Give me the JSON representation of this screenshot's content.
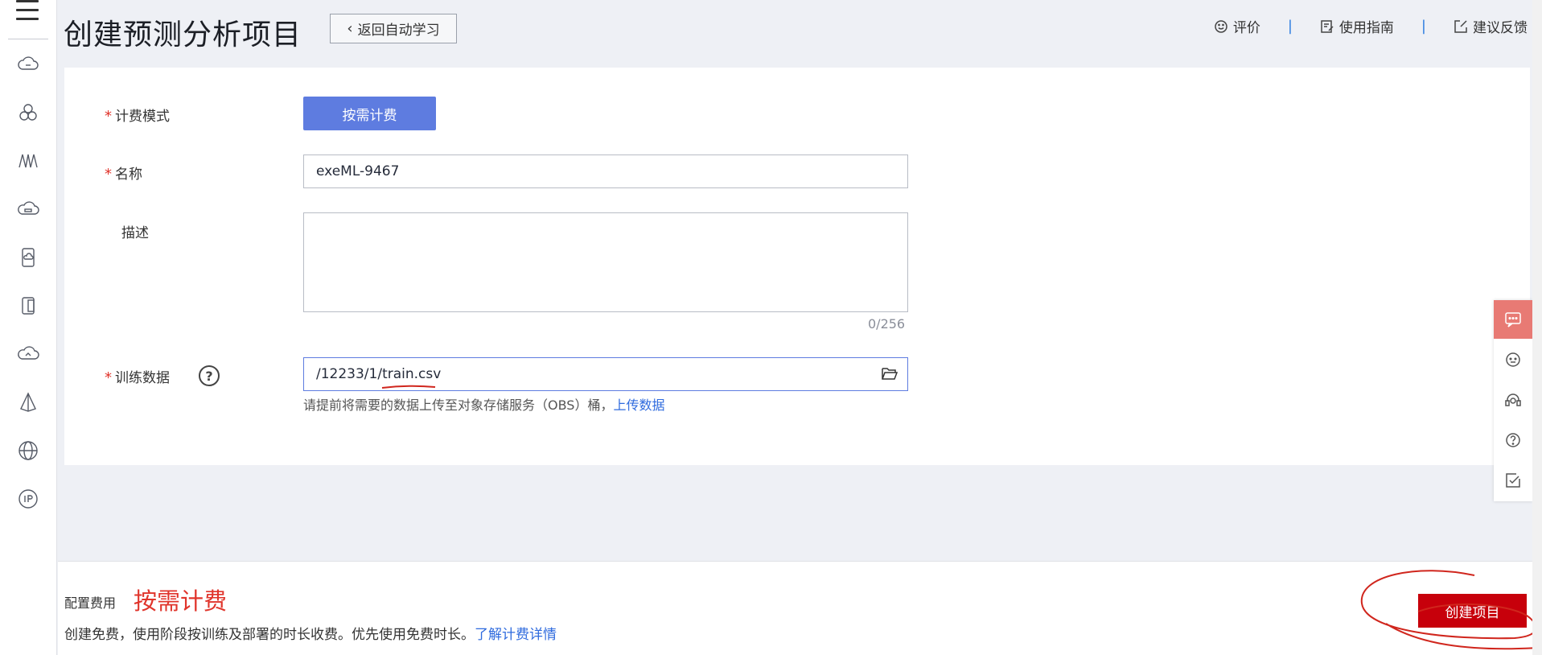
{
  "header": {
    "title": "创建预测分析项目",
    "back_label": "返回自动学习",
    "links": [
      {
        "label": "评价",
        "icon": "smile-icon"
      },
      {
        "label": "使用指南",
        "icon": "guide-icon"
      },
      {
        "label": "建议反馈",
        "icon": "feedback-icon"
      }
    ],
    "separator": "|"
  },
  "rail": {
    "icons": [
      "menu-icon",
      "cloud-icon",
      "cluster-icon",
      "waveform-icon",
      "cloud-storage-icon",
      "mobile-cloud-icon",
      "device-icon",
      "cloud-sync-icon",
      "pyramid-icon",
      "globe-icon",
      "ip-icon"
    ]
  },
  "form": {
    "billing_mode": {
      "label": "计费模式",
      "value": "按需计费"
    },
    "name": {
      "label": "名称",
      "value": "exeML-9467"
    },
    "description": {
      "label": "描述",
      "value": "",
      "counter": "0/256"
    },
    "training_data": {
      "label": "训练数据",
      "help": "?",
      "value": "/12233/1/train.csv",
      "hint": "请提前将需要的数据上传至对象存储服务（OBS）桶，",
      "hint_link": "上传数据"
    },
    "required_mark": "*"
  },
  "footer": {
    "fee_label": "配置费用",
    "fee_value": "按需计费",
    "fee_desc": "创建免费，使用阶段按训练及部署的时长收费。优先使用免费时长。",
    "fee_link": "了解计费详情",
    "create_label": "创建项目"
  },
  "floatbar": {
    "icons": [
      "chat-icon",
      "robot-icon",
      "headset-icon",
      "question-icon",
      "edit-note-icon"
    ]
  },
  "colors": {
    "accent": "#5e7ce0",
    "primary_red": "#c7000b",
    "link": "#2f6bde",
    "required": "#e0342b"
  }
}
